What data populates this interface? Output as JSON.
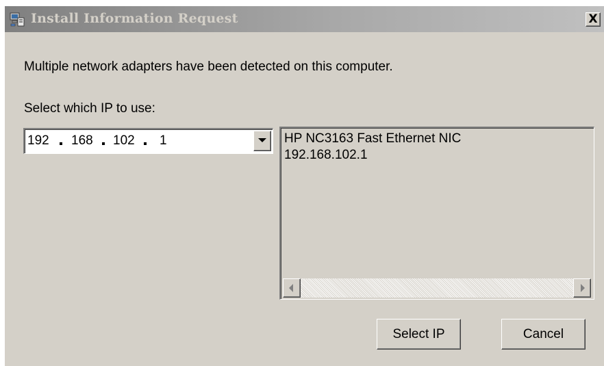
{
  "window": {
    "title": "Install Information Request",
    "close_symbol": "X",
    "icon": "installer-computer-icon"
  },
  "dialog": {
    "message": "Multiple network adapters have been detected on this computer.",
    "select_label": "Select which IP to use:"
  },
  "ip_select": {
    "octets": [
      "192",
      "168",
      "102",
      "1"
    ],
    "dropdown_icon": "chevron-down-icon"
  },
  "details": {
    "adapter_name": "HP NC3163 Fast Ethernet NIC",
    "adapter_ip": "192.168.102.1"
  },
  "buttons": {
    "select_ip": "Select IP",
    "cancel": "Cancel"
  },
  "colors": {
    "face": "#d4d0c8",
    "titlebar_inactive": "#808080",
    "title_text": "#d4d0c8"
  }
}
